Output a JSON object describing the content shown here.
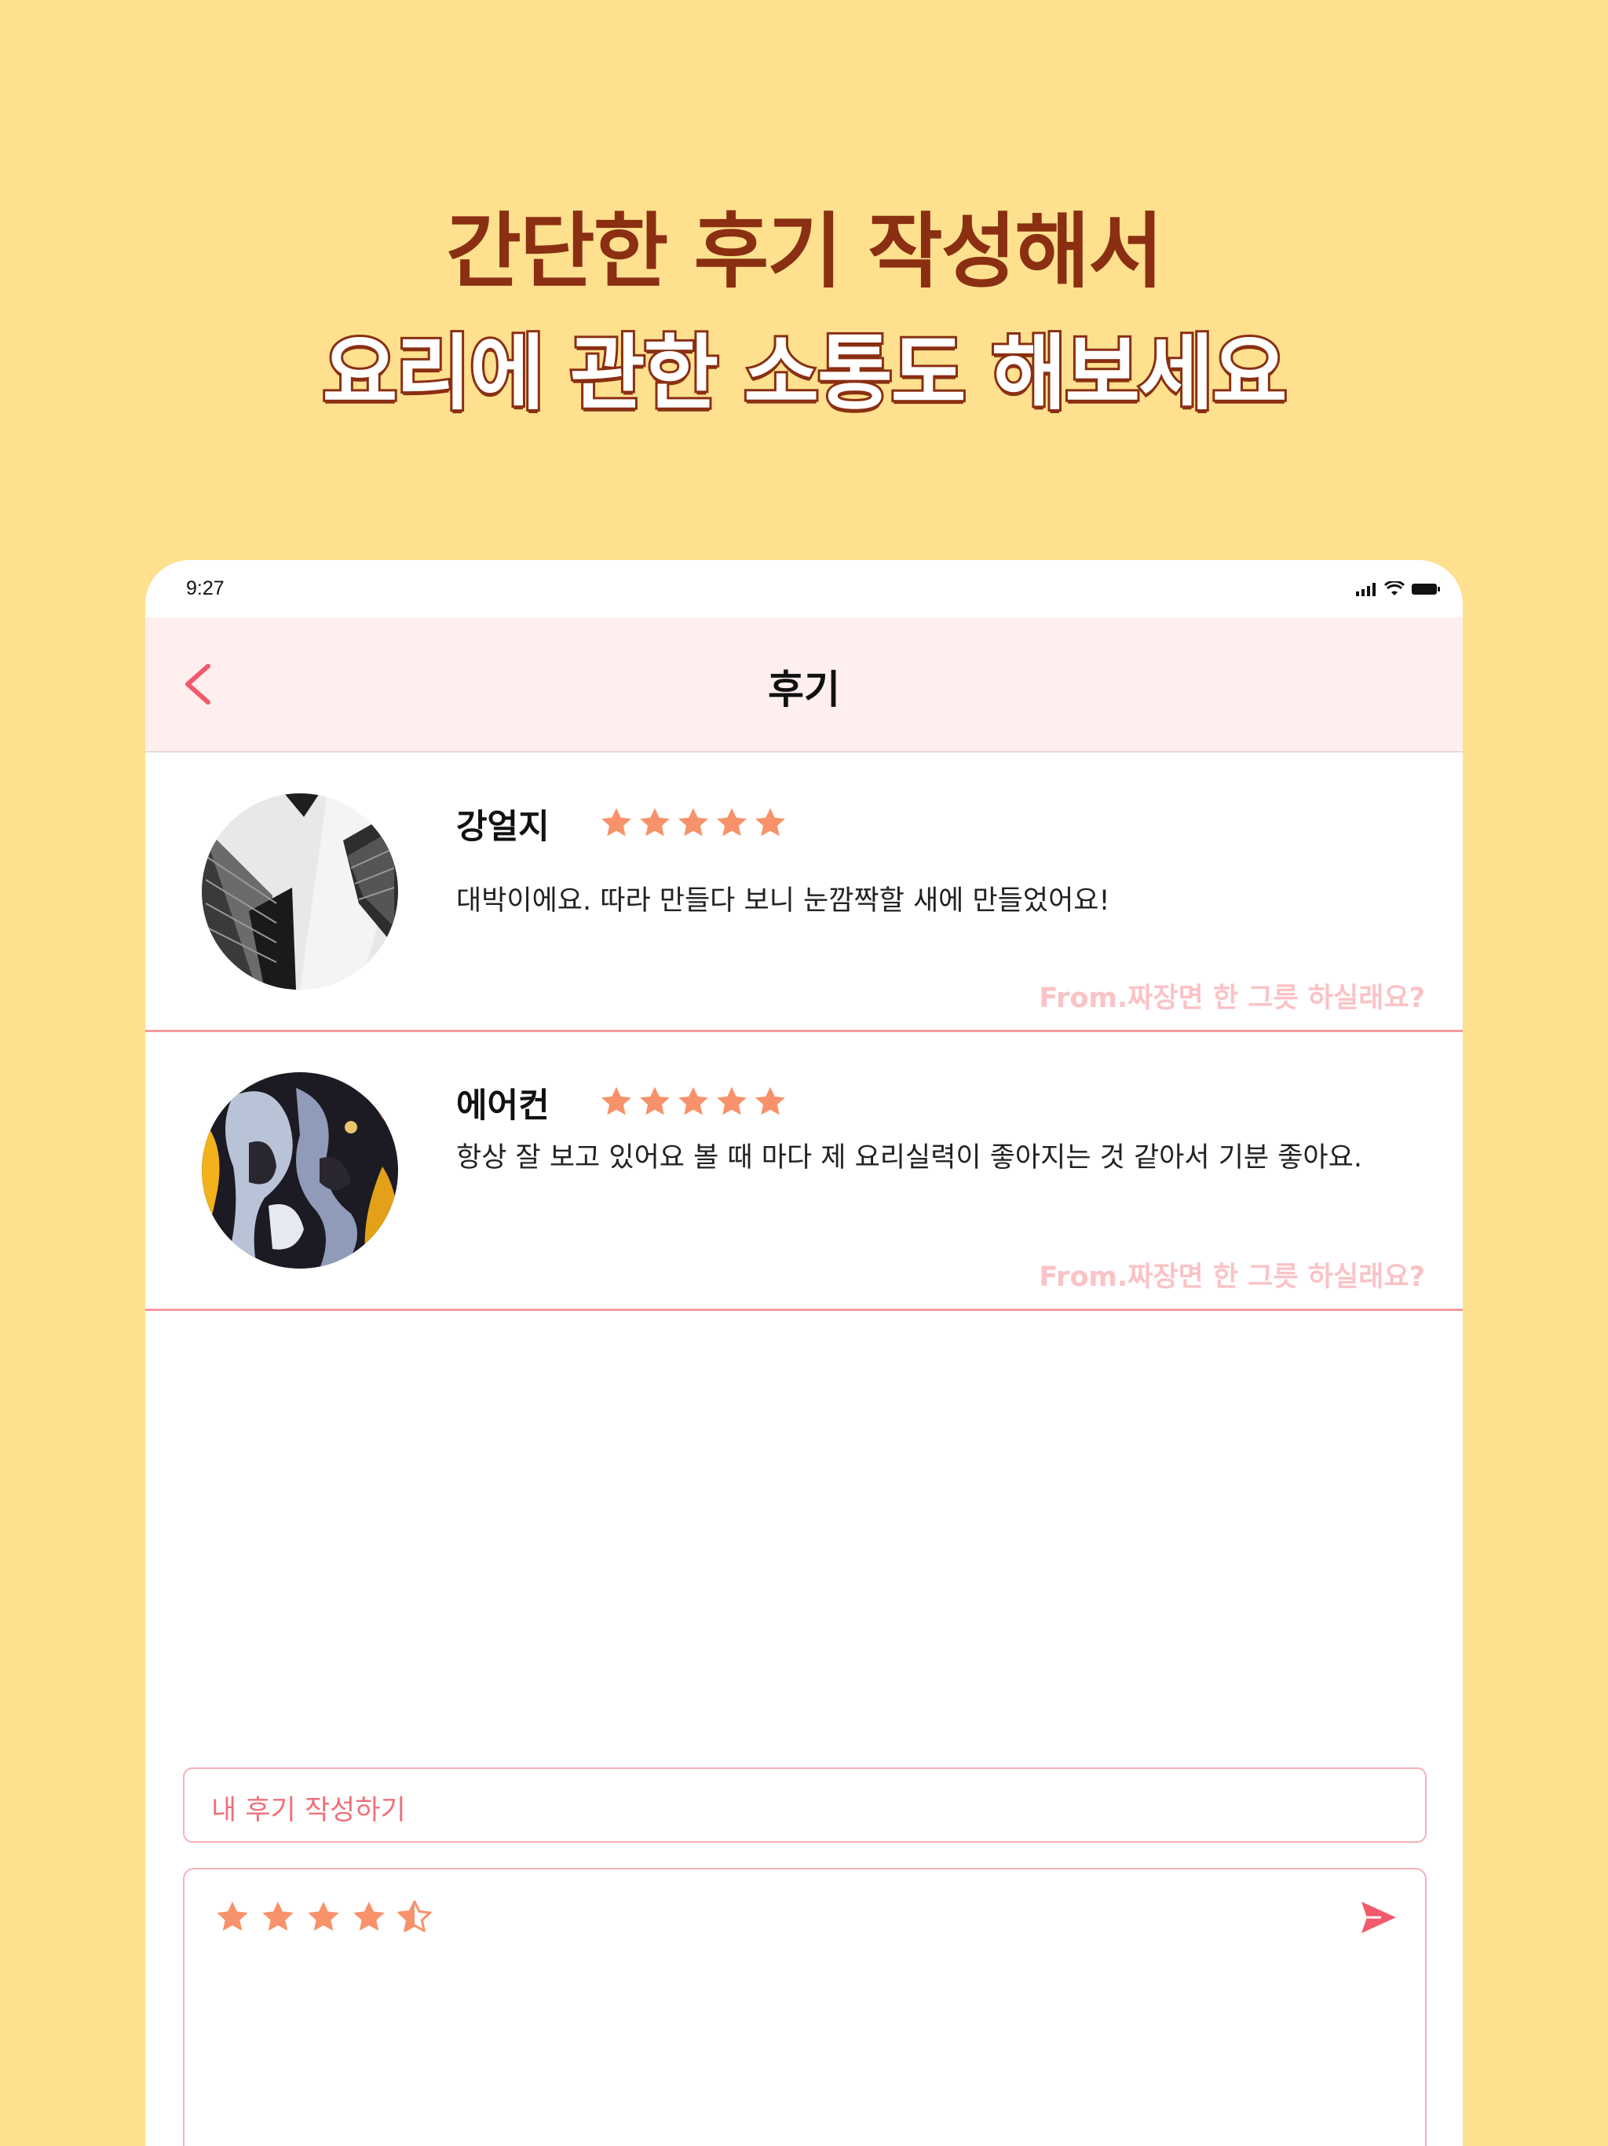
{
  "headline": {
    "line1": "간단한 후기 작성해서",
    "line2": "요리에 관한 소통도 해보세요"
  },
  "status_bar": {
    "time": "9:27"
  },
  "nav": {
    "title": "후기",
    "back_icon": "chevron-left-icon"
  },
  "colors": {
    "background": "#FFE08F",
    "headline": "#8A2F12",
    "accent": "#F05A6A",
    "star": "#F7926A",
    "nav_bg": "#FFEFEF",
    "divider": "#F59AA0",
    "from_text": "#FAC3C6"
  },
  "reviews": [
    {
      "name": "강얼지",
      "rating": 5,
      "text": "대박이에요. 따라 만들다 보니 눈깜짝할 새에 만들었어요!",
      "from": "From.짜장면 한 그릇 하실래요?",
      "avatar": "building-photo"
    },
    {
      "name": "에어컨",
      "rating": 5,
      "text": "항상 잘 보고 있어요 볼 때 마다 제 요리실력이 좋아지는 것 같아서 기분 좋아요.",
      "from": "From.짜장면 한 그릇 하실래요?",
      "avatar": "abstract-paint-photo"
    }
  ],
  "composer": {
    "label": "내 후기 작성하기",
    "rating": 4.5,
    "send_icon": "send-icon"
  }
}
